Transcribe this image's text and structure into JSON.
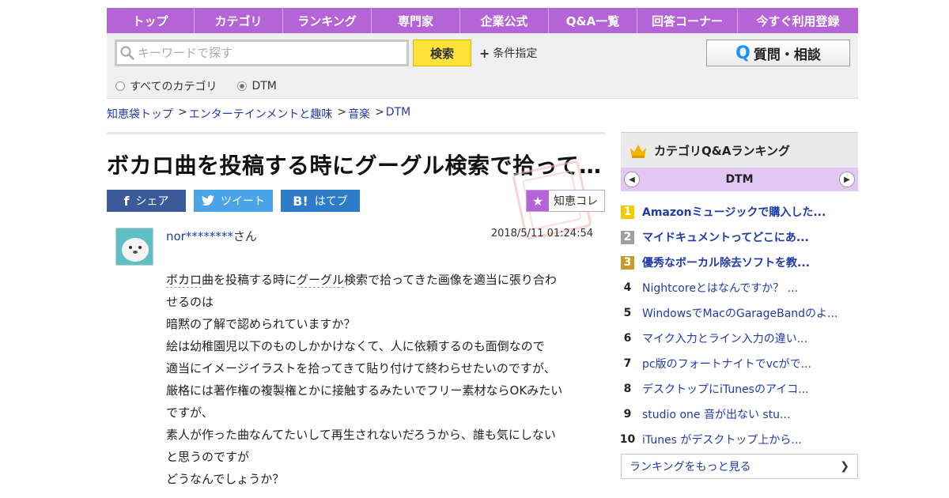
{
  "nav": [
    "トップ",
    "カテゴリ",
    "ランキング",
    "専門家",
    "企業公式",
    "Q&A一覧",
    "回答コーナー",
    "今すぐ利用登録"
  ],
  "search": {
    "placeholder": "キーワードで探す",
    "button": "検索",
    "conditions": "条件指定"
  },
  "ask_button": "質問・相談",
  "radios": {
    "all": "すべてのカテゴリ",
    "current": "DTM"
  },
  "breadcrumb": [
    "知恵袋トップ",
    "エンターテインメントと趣味",
    "音楽",
    "DTM"
  ],
  "question": {
    "title": "ボカロ曲を投稿する時にグーグル検索で拾って…",
    "share": {
      "facebook": "シェア",
      "twitter": "ツイート",
      "hatena": "はてブ",
      "chiecore": "知恵コレ"
    },
    "user": "nor********",
    "user_suffix": "さん",
    "date": "2018/5/11  01:24:54",
    "body": {
      "l1a": "ボカロ",
      "l1b": "曲を投稿する時に",
      "l1c": "グーグル",
      "l1d": "検索で拾ってきた画像を適当に張り合わ",
      "l2": "せるのは",
      "l3": "暗黙の了解で認められていますか？",
      "l4": "絵は幼稚園児以下のものしかかけなくて、人に依頼するのも面倒なので",
      "l5": "適当にイメージイラストを拾ってきて貼り付けて終わらせたいのですが、",
      "l6": "厳格には著作権の複製権とかに接触するみたいでフリー素材ならOKみたい",
      "l7": "ですが、",
      "l8": "素人が作った曲なんてたいして再生されないだろうから、誰も気にしない",
      "l9": "と思うのですが",
      "l10": "どうなんでしょうか？"
    }
  },
  "sidebar": {
    "heading": "カテゴリQ&Aランキング",
    "category": "DTM",
    "ranking": [
      {
        "rank": "1",
        "title": "Amazonミュージックで購入した..."
      },
      {
        "rank": "2",
        "title": "マイドキュメントってどこにあ..."
      },
      {
        "rank": "3",
        "title": "優秀なボーカル除去ソフトを教..."
      },
      {
        "rank": "4",
        "title": "Nightcoreとはなんですか？ ..."
      },
      {
        "rank": "5",
        "title": "WindowsでMacのGarageBandのよ..."
      },
      {
        "rank": "6",
        "title": "マイク入力とライン入力の違い..."
      },
      {
        "rank": "7",
        "title": "pc版のフォートナイトでvcがで..."
      },
      {
        "rank": "8",
        "title": "デスクトップにiTunesのアイコ..."
      },
      {
        "rank": "9",
        "title": "studio one 音が出ない stu..."
      },
      {
        "rank": "10",
        "title": "iTunes がデスクトップ上から..."
      }
    ],
    "more": "ランキングをもっと見る"
  }
}
